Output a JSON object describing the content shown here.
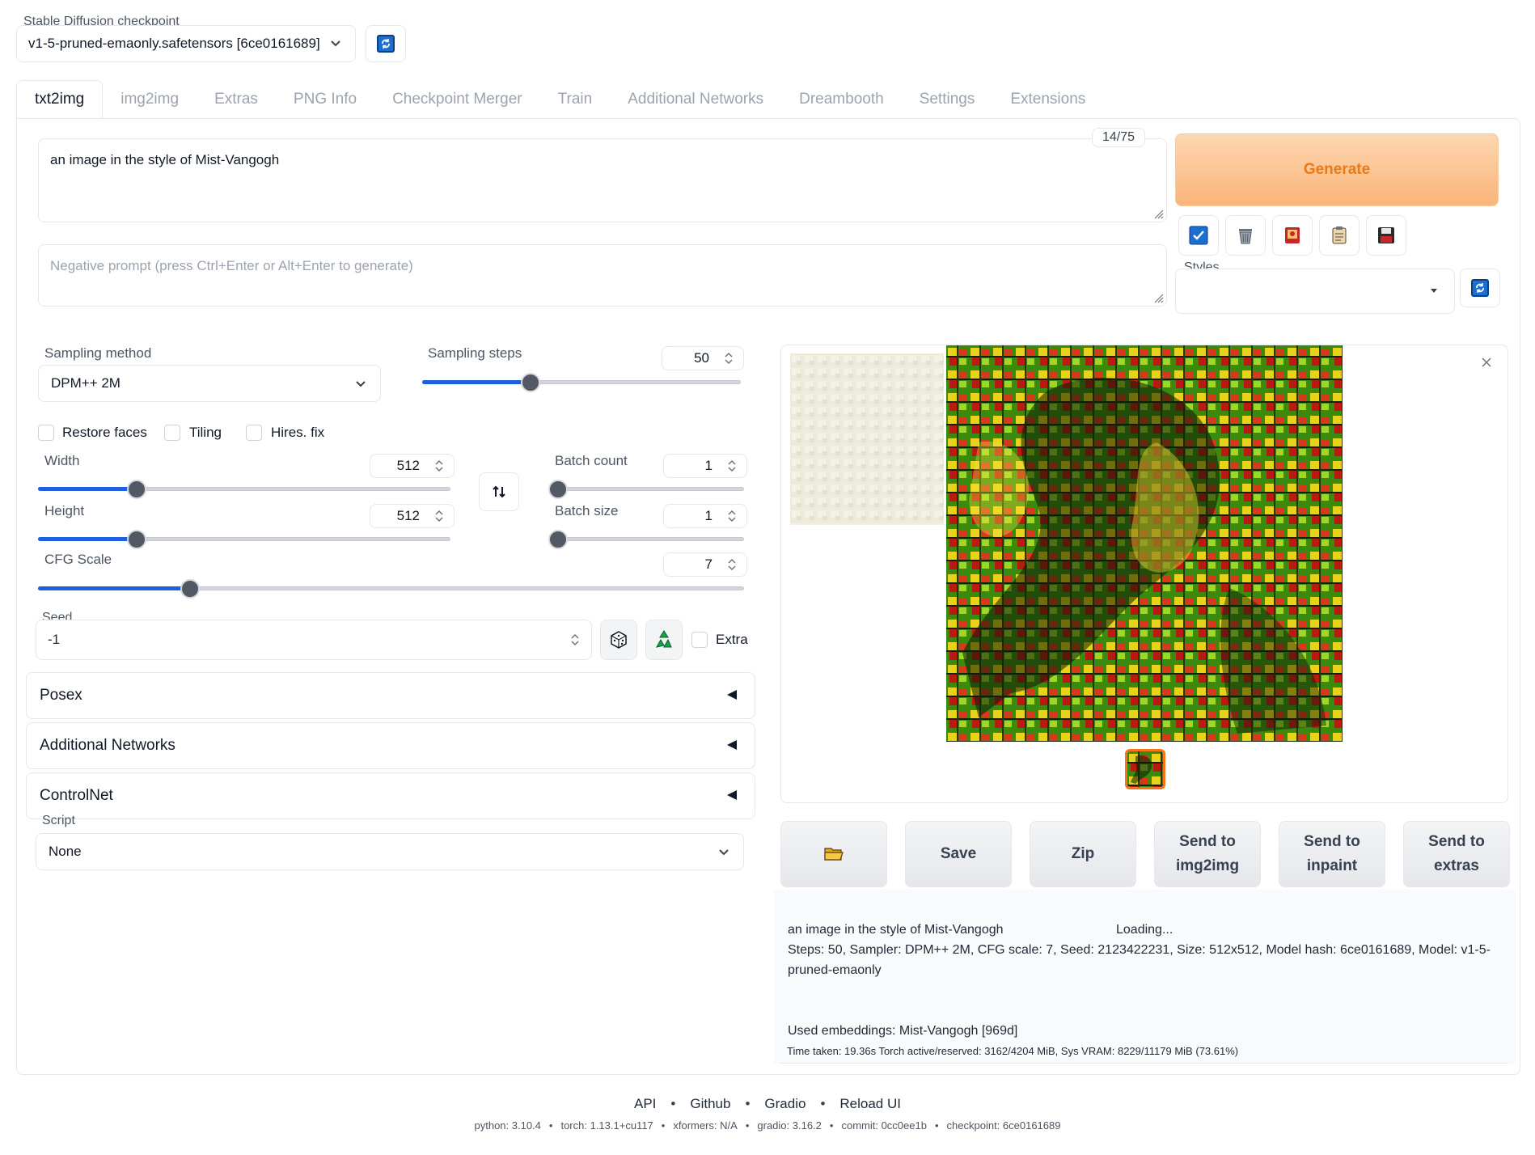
{
  "checkpoint": {
    "label": "Stable Diffusion checkpoint",
    "value": "v1-5-pruned-emaonly.safetensors [6ce0161689]"
  },
  "tabs": [
    {
      "label": "txt2img",
      "active": true
    },
    {
      "label": "img2img"
    },
    {
      "label": "Extras"
    },
    {
      "label": "PNG Info"
    },
    {
      "label": "Checkpoint Merger"
    },
    {
      "label": "Train"
    },
    {
      "label": "Additional Networks"
    },
    {
      "label": "Dreambooth"
    },
    {
      "label": "Settings"
    },
    {
      "label": "Extensions"
    }
  ],
  "prompt": {
    "value": "an image in the style of Mist-Vangogh",
    "token_count": "14/75",
    "negative_placeholder": "Negative prompt (press Ctrl+Enter or Alt+Enter to generate)"
  },
  "generate_label": "Generate",
  "styles_label": "Styles",
  "sampling": {
    "method_label": "Sampling method",
    "method_value": "DPM++ 2M",
    "steps_label": "Sampling steps",
    "steps_value": "50",
    "steps_fraction": 0.34
  },
  "checkboxes": {
    "restore_faces": "Restore faces",
    "tiling": "Tiling",
    "hires_fix": "Hires. fix",
    "extra": "Extra"
  },
  "size": {
    "width_label": "Width",
    "width_value": "512",
    "width_fraction": 0.24,
    "height_label": "Height",
    "height_value": "512",
    "height_fraction": 0.24
  },
  "batch": {
    "count_label": "Batch count",
    "count_value": "1",
    "count_fraction": 0.0,
    "size_label": "Batch size",
    "size_value": "1",
    "size_fraction": 0.0
  },
  "cfg": {
    "label": "CFG Scale",
    "value": "7",
    "fraction": 0.215
  },
  "seed": {
    "label": "Seed",
    "value": "-1"
  },
  "accordions": [
    "Posex",
    "Additional Networks",
    "ControlNet"
  ],
  "script": {
    "label": "Script",
    "value": "None"
  },
  "actions": {
    "save": "Save",
    "zip": "Zip",
    "send_img2img_1": "Send to",
    "send_img2img_2": "img2img",
    "send_inpaint_1": "Send to",
    "send_inpaint_2": "inpaint",
    "send_extras_1": "Send to",
    "send_extras_2": "extras"
  },
  "info": {
    "prompt_line": "an image in the style of Mist-Vangogh",
    "loading": "Loading...",
    "params_line1": "Steps: 50, Sampler: DPM++ 2M, CFG scale: 7, Seed: 2123422231, Size: 512x512, Model hash: 6ce0161689, Model: v1-5-",
    "params_line2": "pruned-emaonly",
    "embeddings": "Used embeddings: Mist-Vangogh [969d]",
    "time": "Time taken: 19.36s  Torch active/reserved: 3162/4204 MiB, Sys VRAM: 8229/11179 MiB (73.61%)"
  },
  "footer": {
    "links": [
      "API",
      "Github",
      "Gradio",
      "Reload UI"
    ],
    "versions": [
      "python: 3.10.4",
      "torch: 1.13.1+cu117",
      "xformers: N/A",
      "gradio: 3.16.2",
      "commit: 0cc0ee1b",
      "checkpoint: 6ce0161689"
    ]
  },
  "colors": {
    "accent_blue": "#1d5fdc",
    "generate_orange": "#ea7a16",
    "selected_thumb_border": "#f97316"
  }
}
